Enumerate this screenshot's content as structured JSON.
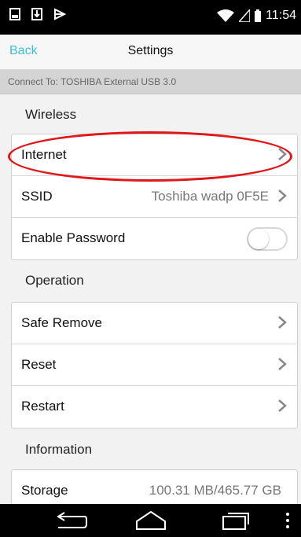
{
  "status_bar": {
    "time": "11:54",
    "icons_left": [
      "screenshot-icon",
      "download-icon",
      "media-icon"
    ],
    "icons_right": [
      "wifi-icon",
      "signal-icon",
      "battery-icon"
    ]
  },
  "nav": {
    "back_label": "Back",
    "title": "Settings"
  },
  "connect_banner": "Connect To: TOSHIBA  External USB 3.0",
  "sections": [
    {
      "header": "Wireless",
      "rows": [
        {
          "label": "Internet",
          "value": "",
          "control": "chevron"
        },
        {
          "label": "SSID",
          "value": "Toshiba wadp 0F5E",
          "control": "chevron"
        },
        {
          "label": "Enable Password",
          "value": "",
          "control": "toggle",
          "toggle_on": false
        }
      ]
    },
    {
      "header": "Operation",
      "rows": [
        {
          "label": "Safe Remove",
          "value": "",
          "control": "chevron"
        },
        {
          "label": "Reset",
          "value": "",
          "control": "chevron"
        },
        {
          "label": "Restart",
          "value": "",
          "control": "chevron"
        }
      ]
    },
    {
      "header": "Information",
      "rows": [
        {
          "label": "Storage",
          "value": "100.31 MB/465.77 GB",
          "control": "none"
        }
      ]
    }
  ],
  "annotation": {
    "shape": "ellipse",
    "color": "#e0171a",
    "target": "Internet"
  },
  "colors": {
    "accent": "#3bbfd6",
    "status_bar": "#000000",
    "background": "#f2f2f2"
  },
  "bottom_nav": {
    "icons": [
      "back-icon",
      "home-icon",
      "recents-icon",
      "menu-icon"
    ]
  }
}
